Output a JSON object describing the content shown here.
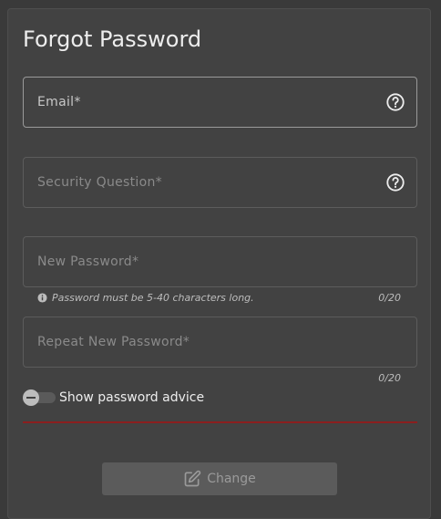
{
  "title": "Forgot Password",
  "fields": {
    "email": {
      "label": "Email*",
      "help_icon": "help-circle-icon"
    },
    "security_question": {
      "label": "Security Question*",
      "help_icon": "help-circle-icon"
    },
    "new_password": {
      "label": "New Password*",
      "hint": "Password must be 5-40 characters long.",
      "counter": "0/20"
    },
    "repeat_password": {
      "label": "Repeat New Password*",
      "counter": "0/20"
    }
  },
  "toggle": {
    "label": "Show password advice",
    "state": "off"
  },
  "button": {
    "label": "Change",
    "icon": "edit-icon"
  },
  "colors": {
    "background": "#424242",
    "divider": "#8b1f1f",
    "button_disabled": "#5b5b5b"
  }
}
